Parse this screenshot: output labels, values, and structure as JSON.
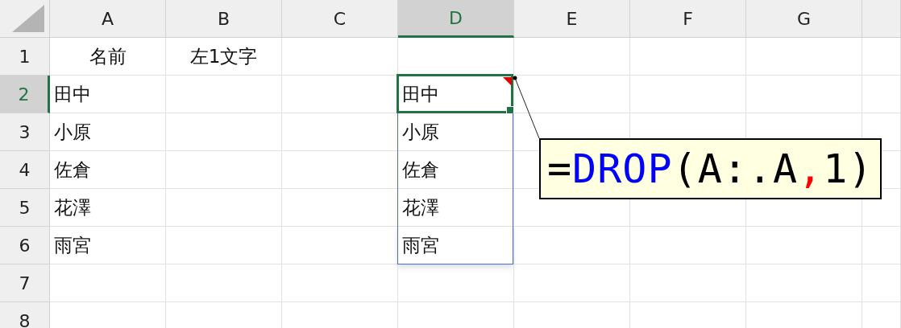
{
  "columns": [
    {
      "label": "A",
      "selected": false
    },
    {
      "label": "B",
      "selected": false
    },
    {
      "label": "C",
      "selected": false
    },
    {
      "label": "D",
      "selected": true
    },
    {
      "label": "E",
      "selected": false
    },
    {
      "label": "F",
      "selected": false
    },
    {
      "label": "G",
      "selected": false
    }
  ],
  "rows": [
    {
      "label": "1",
      "selected": false,
      "cells": [
        {
          "kind": "heading",
          "text": "名前",
          "active": false,
          "spill": false,
          "note": false
        },
        {
          "kind": "heading",
          "text": "左1文字",
          "active": false,
          "spill": false,
          "note": false
        }
      ]
    },
    {
      "label": "2",
      "selected": true,
      "cells": [
        {
          "kind": "value",
          "text": "田中",
          "active": false,
          "spill": false,
          "note": false
        },
        null,
        null,
        {
          "kind": "value",
          "text": "田中",
          "active": true,
          "spill": true,
          "note": true
        }
      ]
    },
    {
      "label": "3",
      "selected": false,
      "cells": [
        {
          "kind": "value",
          "text": "小原",
          "active": false,
          "spill": false,
          "note": false
        },
        null,
        null,
        {
          "kind": "value",
          "text": "小原",
          "active": false,
          "spill": true,
          "note": false
        }
      ]
    },
    {
      "label": "4",
      "selected": false,
      "cells": [
        {
          "kind": "value",
          "text": "佐倉",
          "active": false,
          "spill": false,
          "note": false
        },
        null,
        null,
        {
          "kind": "value",
          "text": "佐倉",
          "active": false,
          "spill": true,
          "note": false
        }
      ]
    },
    {
      "label": "5",
      "selected": false,
      "cells": [
        {
          "kind": "value",
          "text": "花澤",
          "active": false,
          "spill": false,
          "note": false
        },
        null,
        null,
        {
          "kind": "value",
          "text": "花澤",
          "active": false,
          "spill": true,
          "note": false
        }
      ]
    },
    {
      "label": "6",
      "selected": false,
      "cells": [
        {
          "kind": "value",
          "text": "雨宮",
          "active": false,
          "spill": false,
          "note": false
        },
        null,
        null,
        {
          "kind": "value",
          "text": "雨宮",
          "active": false,
          "spill": true,
          "note": false
        }
      ]
    },
    {
      "label": "7",
      "selected": false,
      "cells": []
    },
    {
      "label": "8",
      "selected": false,
      "cells": []
    }
  ],
  "callout": {
    "segments": [
      {
        "text": "=",
        "color": "#000000"
      },
      {
        "text": "DROP",
        "color": "#0000ff"
      },
      {
        "text": "(A:.A",
        "color": "#000000"
      },
      {
        "text": ",",
        "color": "#ff0000"
      },
      {
        "text": "1)",
        "color": "#000000"
      }
    ]
  }
}
